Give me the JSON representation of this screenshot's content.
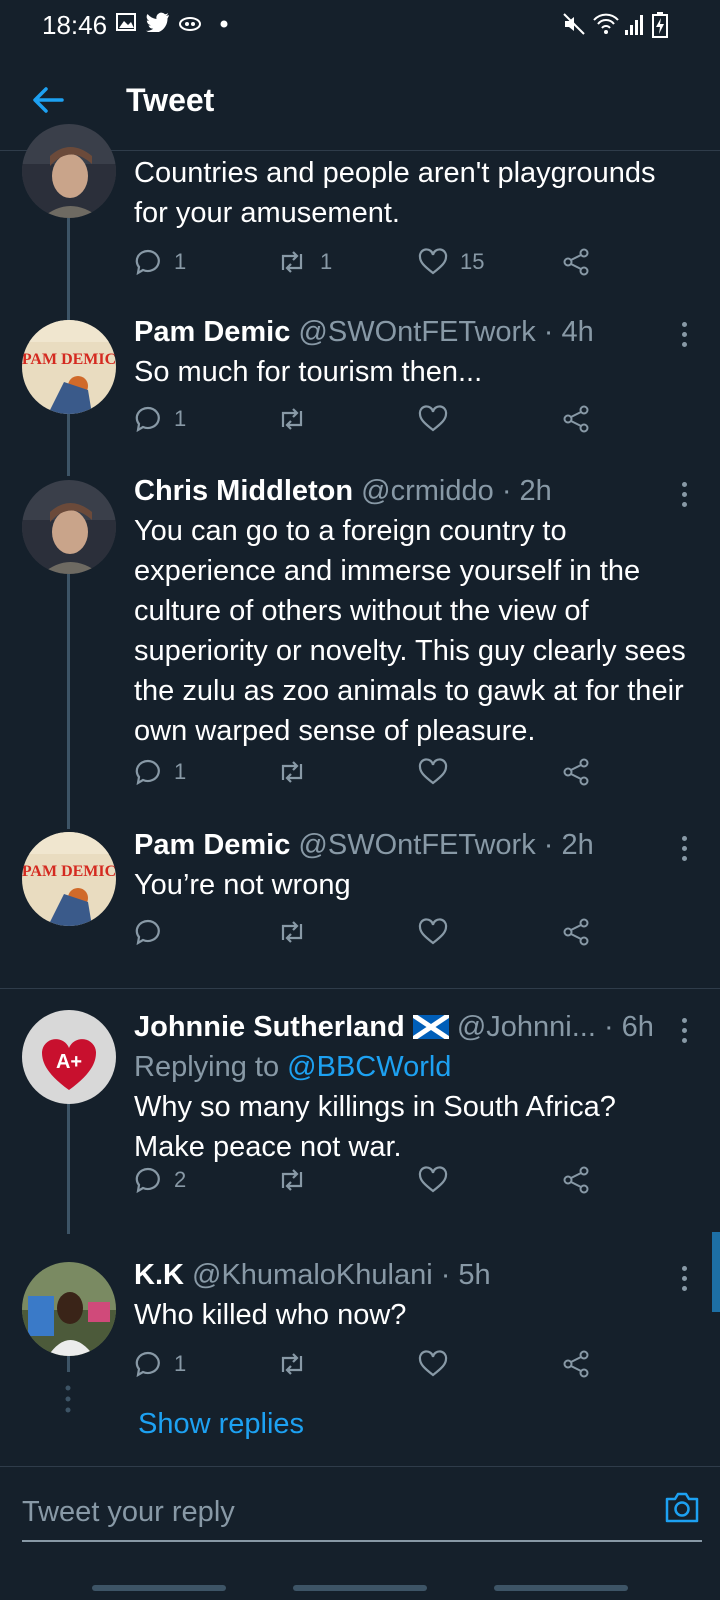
{
  "status_bar": {
    "time": "18:46"
  },
  "header": {
    "title": "Tweet"
  },
  "tweets": [
    {
      "name": "",
      "handle": "",
      "time": "",
      "text": "Countries and people aren't playgrounds for your amusement.",
      "reply_count": "1",
      "retweet_count": "1",
      "like_count": "15"
    },
    {
      "name": "Pam Demic",
      "handle": "@SWOntFETwork",
      "time": "· 4h",
      "text": "So much for tourism then...",
      "reply_count": "1",
      "retweet_count": "",
      "like_count": ""
    },
    {
      "name": "Chris Middleton",
      "handle": "@crmiddo",
      "time": "· 2h",
      "text": "You can go to a foreign country to experience and immerse yourself in the culture of others without the view of superiority or novelty. This guy clearly sees the zulu as zoo animals to gawk at for their own warped sense of pleasure.",
      "reply_count": "1",
      "retweet_count": "",
      "like_count": ""
    },
    {
      "name": "Pam Demic",
      "handle": "@SWOntFETwork",
      "time": "· 2h",
      "text": "You’re not wrong",
      "reply_count": "",
      "retweet_count": "",
      "like_count": ""
    },
    {
      "name": "Johnnie Sutherland",
      "handle": "@Johnni...",
      "time": "· 6h",
      "replying_label": "Replying to",
      "replying_to": "@BBCWorld",
      "text": "Why so many killings in South Africa? Make peace not war.",
      "reply_count": "2",
      "retweet_count": "",
      "like_count": ""
    },
    {
      "name": "K.K",
      "handle": "@KhumaloKhulani",
      "time": "· 5h",
      "text": "Who killed who now?",
      "reply_count": "1",
      "retweet_count": "",
      "like_count": ""
    }
  ],
  "avatars": {
    "pam_demic_text": "PAM DEMIC",
    "johnnie_badge": "A+"
  },
  "show_replies": "Show replies",
  "reply_box": {
    "placeholder": "Tweet your reply"
  },
  "colors": {
    "background": "#15202b",
    "accent": "#1da1f2",
    "muted": "#8899a6",
    "divider": "#2f3c4a"
  }
}
